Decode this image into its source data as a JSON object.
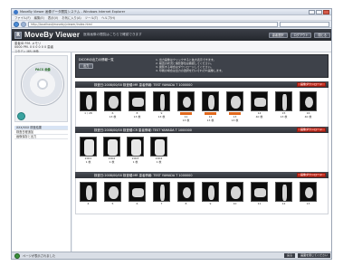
{
  "browser": {
    "title": "MoveBy Viewer 画像データ閲覧システム - Windows Internet Explorer",
    "menu": [
      "ファイル(F)",
      "編集(E)",
      "表示(V)",
      "お気に入り(A)",
      "ツール(T)",
      "ヘルプ(H)"
    ],
    "url": "http://localhost/moveby/viewer/index.html"
  },
  "app": {
    "logo_letter": "R",
    "name": "MoveBy Viewer",
    "subtitle": "医用画像の閲覧はこちらで確認できます",
    "buttons": [
      "患者選択",
      "ログアウト",
      "閉じる"
    ]
  },
  "patient": {
    "line1": "患者ID    P.M. メモリ",
    "line2": "0000  PM. 0 0 0   0 0 0  患者",
    "tabs": "スタディ   MRI  画像"
  },
  "left": {
    "disc_brand": "PACS 画像",
    "items": [
      "XXX/XXX  検査結果",
      "検査日程追加",
      "画像保存と出力"
    ]
  },
  "notice": {
    "title": "DICOMの出力の情報一覧",
    "button": "出力",
    "lines": [
      "1. 出力画像はクリックすると拡大表示できます。",
      "2. 検査の状況と撮影部位は確認してください。",
      "3. 閲覧する場合はダウンロードしてください。",
      "4. 印刷の場合は出力の選択を行いそれぞれ画像します。"
    ]
  },
  "studies": [
    {
      "header": "検査日:2008/00/00   検査種:MR   患者情報:  TEST YAMADA T  1000000",
      "button": "画像ダウンロード",
      "thumbs": [
        {
          "l1": "",
          "l2": "1 / 28"
        },
        {
          "l1": "6",
          "l2": "13 枚"
        },
        {
          "l1": "8",
          "l2": "13 枚"
        },
        {
          "l1": "9",
          "l2": "13 枚"
        },
        {
          "l1": "11",
          "l2": "13 枚"
        },
        {
          "l1": "12",
          "l2": "13 枚"
        },
        {
          "l1": "13",
          "l2": "13 枚"
        },
        {
          "l1": "14",
          "l2": "40 枚"
        },
        {
          "l1": "15",
          "l2": "13 枚"
        },
        {
          "l1": "16",
          "l2": "40 枚"
        }
      ]
    },
    {
      "header": "検査日:2008/00/00   検査種:CR   患者情報:  TEST YAMADA T  1000000",
      "button": "画像ダウンロード",
      "thumbs": [
        {
          "l1": "2001",
          "l2": "1 枚"
        },
        {
          "l1": "2002",
          "l2": "1 枚"
        },
        {
          "l1": "2003",
          "l2": "1 枚"
        },
        {
          "l1": "2004",
          "l2": "1 枚"
        }
      ]
    },
    {
      "header": "検査日:2008/00/00   検査種:MR   患者情報:  TEST YAMADA T  1000000",
      "button": "画像ダウンロード",
      "thumbs": [
        {
          "l1": "4",
          "l2": ""
        },
        {
          "l1": "5",
          "l2": ""
        },
        {
          "l1": "6",
          "l2": ""
        },
        {
          "l1": "7",
          "l2": ""
        },
        {
          "l1": "8",
          "l2": ""
        },
        {
          "l1": "9",
          "l2": ""
        },
        {
          "l1": "10",
          "l2": ""
        },
        {
          "l1": "11",
          "l2": ""
        },
        {
          "l1": "12",
          "l2": ""
        },
        {
          "l1": "13",
          "l2": ""
        }
      ]
    }
  ],
  "status": {
    "left": "ページが表示されました",
    "buttons": [
      "戻る",
      "画面を閉じてください"
    ]
  },
  "colors": {
    "header_dark": "#2b2e34",
    "download_red": "#d2321f",
    "badge_orange": "#e26a1e",
    "disc_teal": "#3aa3a0"
  }
}
